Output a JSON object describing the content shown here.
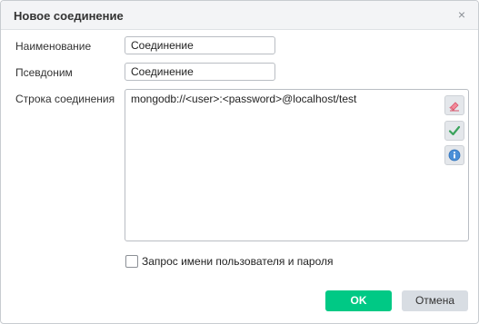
{
  "dialog": {
    "title": "Новое соединение",
    "close_glyph": "×"
  },
  "form": {
    "name_label": "Наименование",
    "name_value": "Соединение",
    "alias_label": "Псевдоним",
    "alias_value": "Соединение",
    "conn_label": "Строка соединения",
    "conn_value": "mongodb://<user>:<password>@localhost/test",
    "side_buttons": [
      "eraser-icon",
      "check-icon",
      "info-icon"
    ],
    "prompt_label": "Запрос имени пользователя и пароля",
    "prompt_checked": false
  },
  "footer": {
    "ok_label": "OK",
    "cancel_label": "Отмена"
  },
  "colors": {
    "ok_bg": "#00c985",
    "cancel_bg": "#d8dde3",
    "titlebar_bg": "#f3f4f6"
  }
}
